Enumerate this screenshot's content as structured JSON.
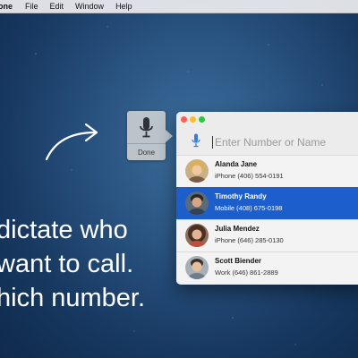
{
  "menubar": {
    "app_name": "one",
    "items": [
      "File",
      "Edit",
      "Window",
      "Help"
    ]
  },
  "tagline": {
    "line1": "dictate who",
    "line2": "want to call.",
    "line3": "hich number."
  },
  "dictation": {
    "done_label": "Done",
    "icon": "microphone-icon"
  },
  "window": {
    "search": {
      "placeholder": "Enter Number or Name",
      "icon": "microphone-icon"
    },
    "contacts": [
      {
        "name": "Alanda Jane",
        "number": "iPhone  (406) 554-0191",
        "selected": false
      },
      {
        "name": "Timothy Randy",
        "number": "Mobile  (408) 675-0198",
        "selected": true
      },
      {
        "name": "Julia Mendez",
        "number": "iPhone  (646) 285-0130",
        "selected": false
      },
      {
        "name": "Scott Biender",
        "number": "Work  (646) 861-2889",
        "selected": false
      }
    ]
  },
  "colors": {
    "selection": "#1c5fcc",
    "background_top": "#3d6f9c",
    "background_bottom": "#0f2a4c",
    "mic_blue": "#3a7bd5"
  }
}
